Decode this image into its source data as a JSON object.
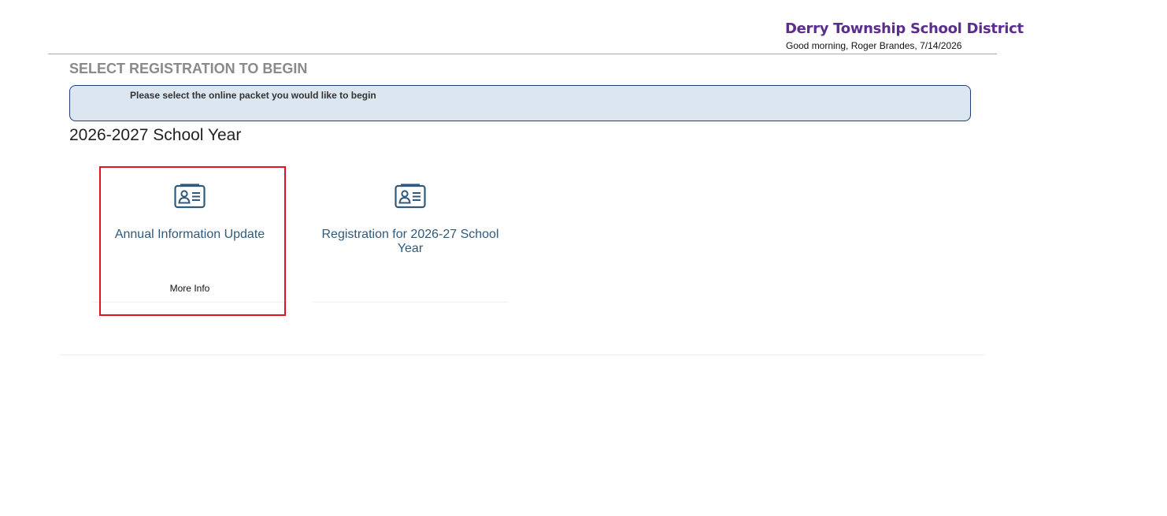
{
  "header": {
    "district_name": "Derry Township School District",
    "greeting": "Good morning, Roger Brandes, 7/14/2026"
  },
  "main": {
    "section_title": "SELECT REGISTRATION TO BEGIN",
    "instruction": "Please select the online packet you would like to begin",
    "school_year": "2026-2027 School Year",
    "cards": [
      {
        "icon": "id-card-icon",
        "title": "Annual Information Update",
        "more_info": "More Info",
        "highlighted": true
      },
      {
        "icon": "id-card-icon",
        "title": "Registration for 2026-27 School Year",
        "more_info": "",
        "highlighted": false
      }
    ]
  },
  "colors": {
    "district_name": "#5b2d8e",
    "instruction_bg": "#dce6f1",
    "instruction_border": "#1f3f76",
    "card_text": "#2e5a7d",
    "highlight": "#e0141a"
  }
}
